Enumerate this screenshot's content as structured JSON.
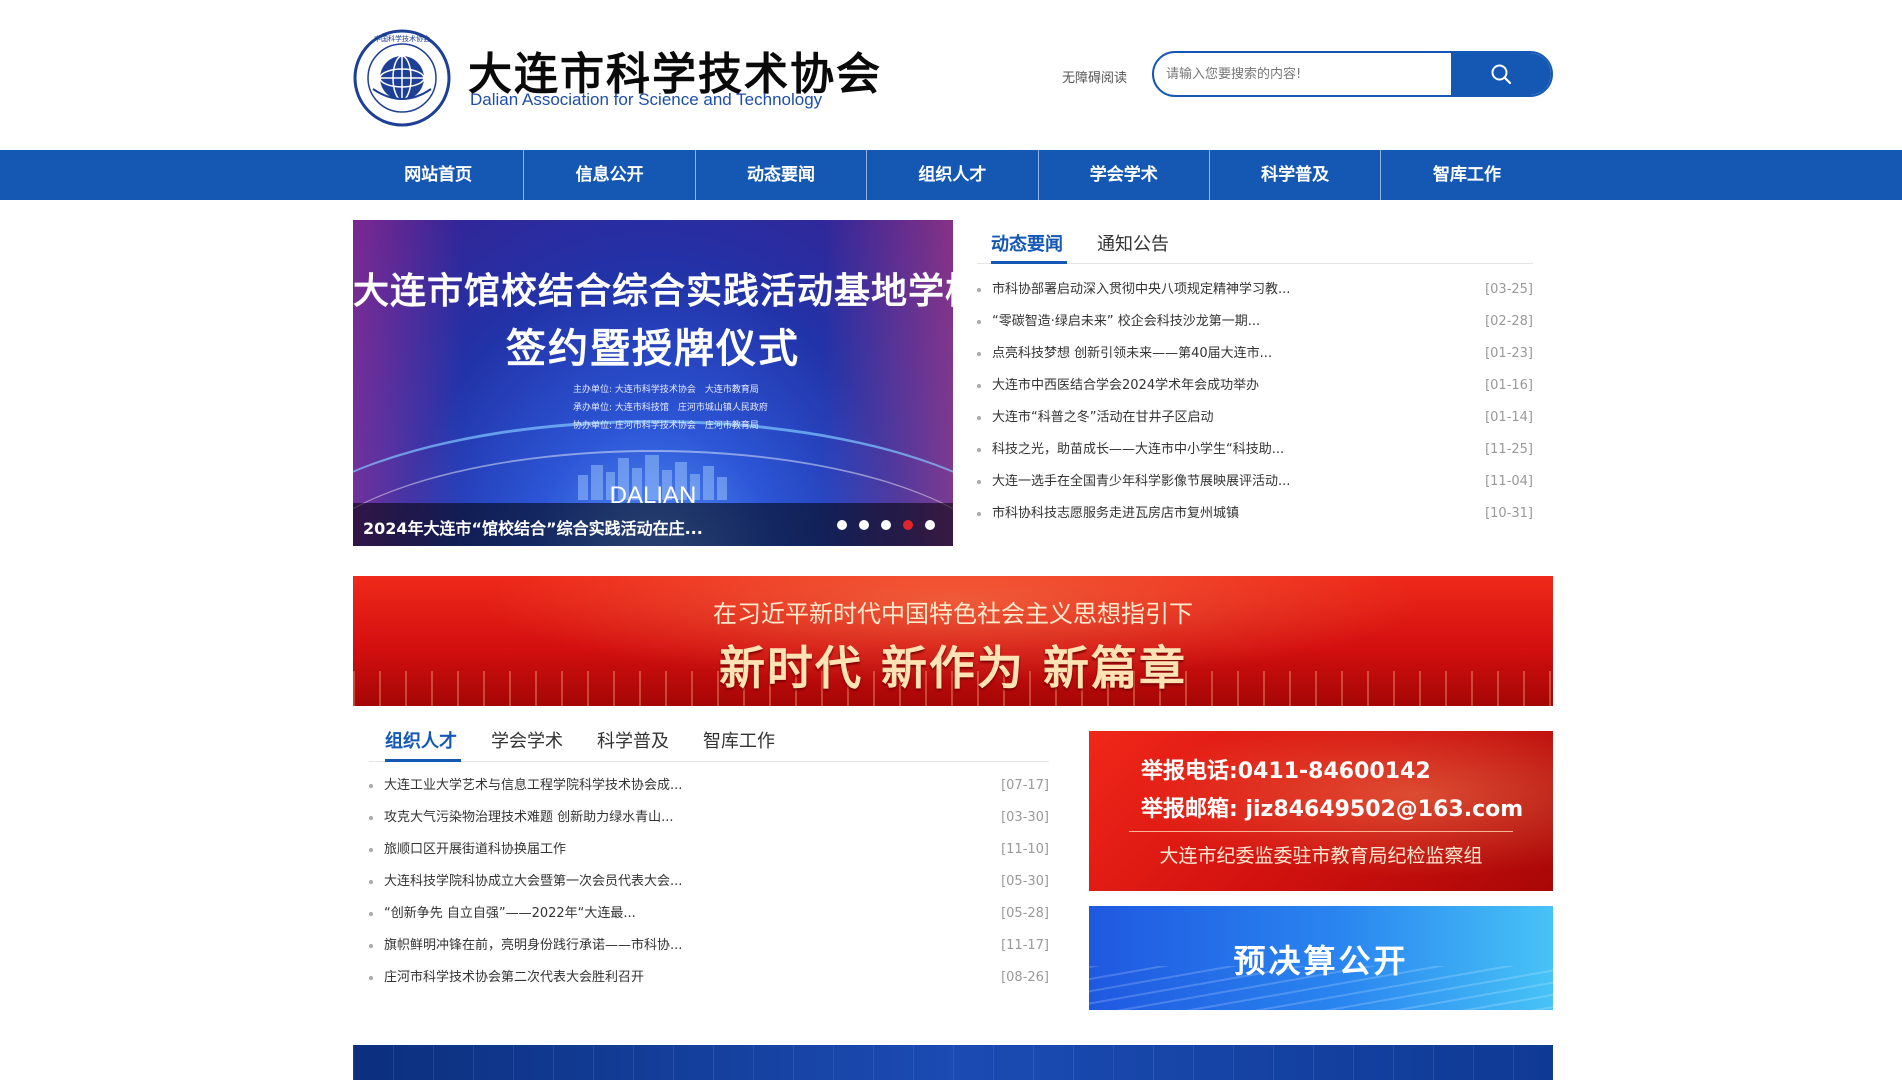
{
  "header": {
    "title_cn": "大连市科学技术协会",
    "title_en": "Dalian Association for Science and Technology",
    "accessible_reading": "无障碍阅读",
    "search_placeholder": "请输入您要搜索的内容!",
    "search_icon": "search-icon",
    "logo": {
      "name": "association-logo",
      "text": "中国科学技术协会 CHINA ASSOCIATION FOR SCIENCE AND TECHNOLOGY"
    }
  },
  "nav": {
    "items": [
      {
        "label": "网站首页"
      },
      {
        "label": "信息公开"
      },
      {
        "label": "动态要闻"
      },
      {
        "label": "组织人才"
      },
      {
        "label": "学会学术"
      },
      {
        "label": "科学普及"
      },
      {
        "label": "智库工作"
      }
    ]
  },
  "carousel": {
    "slide_title_line1": "大连市馆校结合综合实践活动基地学校",
    "slide_title_line2": "签约暨授牌仪式",
    "slide_small_lines": [
      "主办单位: 大连市科学技术协会　大连市教育局",
      "承办单位: 大连市科技馆　庄河市城山镇人民政府",
      "协办单位: 庄河市科学技术协会　庄河市教育局"
    ],
    "slide_dalian": "DALIAN",
    "caption": "2024年大连市“馆校结合”综合实践活动在庄...",
    "dots_count": 5,
    "active_dot_index": 3
  },
  "news_panel": {
    "tabs": [
      {
        "label": "动态要闻",
        "active": true
      },
      {
        "label": "通知公告",
        "active": false
      }
    ],
    "items": [
      {
        "title": "市科协部署启动深入贯彻中央八项规定精神学习教...",
        "date": "[03-25]"
      },
      {
        "title": "“零碳智造·绿启未来” 校企会科技沙龙第一期...",
        "date": "[02-28]"
      },
      {
        "title": "点亮科技梦想 创新引领未来——第40届大连市...",
        "date": "[01-23]"
      },
      {
        "title": "大连市中西医结合学会2024学术年会成功举办",
        "date": "[01-16]"
      },
      {
        "title": "大连市“科普之冬”活动在甘井子区启动",
        "date": "[01-14]"
      },
      {
        "title": "科技之光，助苗成长——大连市中小学生“科技助...",
        "date": "[11-25]"
      },
      {
        "title": "大连一选手在全国青少年科学影像节展映展评活动...",
        "date": "[11-04]"
      },
      {
        "title": "市科协科技志愿服务走进瓦房店市复州城镇",
        "date": "[10-31]"
      }
    ]
  },
  "red_banner": {
    "subtitle": "在习近平新时代中国特色社会主义思想指引下",
    "main": "新时代 新作为 新篇章"
  },
  "lower_panel": {
    "tabs": [
      {
        "label": "组织人才",
        "active": true
      },
      {
        "label": "学会学术",
        "active": false
      },
      {
        "label": "科学普及",
        "active": false
      },
      {
        "label": "智库工作",
        "active": false
      }
    ],
    "items": [
      {
        "title": "大连工业大学艺术与信息工程学院科学技术协会成...",
        "date": "[07-17]"
      },
      {
        "title": "攻克大气污染物治理技术难题 创新助力绿水青山...",
        "date": "[03-30]"
      },
      {
        "title": "旅顺口区开展街道科协换届工作",
        "date": "[11-10]"
      },
      {
        "title": "大连科技学院科协成立大会暨第一次会员代表大会...",
        "date": "[05-30]"
      },
      {
        "title": "“创新争先 自立自强”——2022年“大连最...",
        "date": "[05-28]"
      },
      {
        "title": "旗帜鲜明冲锋在前，亮明身份践行承诺——市科协...",
        "date": "[11-17]"
      },
      {
        "title": "庄河市科学技术协会第二次代表大会胜利召开",
        "date": "[08-26]"
      }
    ]
  },
  "report_banner": {
    "phone": "举报电话:0411-84600142",
    "email": "举报邮箱: jiz84649502@163.com",
    "org": "大连市纪委监委驻市教育局纪检监察组"
  },
  "budget_banner": {
    "text": "预决算公开"
  },
  "colors": {
    "brand_blue": "#1558b4",
    "red": "#d40f0f",
    "active_dot": "#e0262a"
  }
}
